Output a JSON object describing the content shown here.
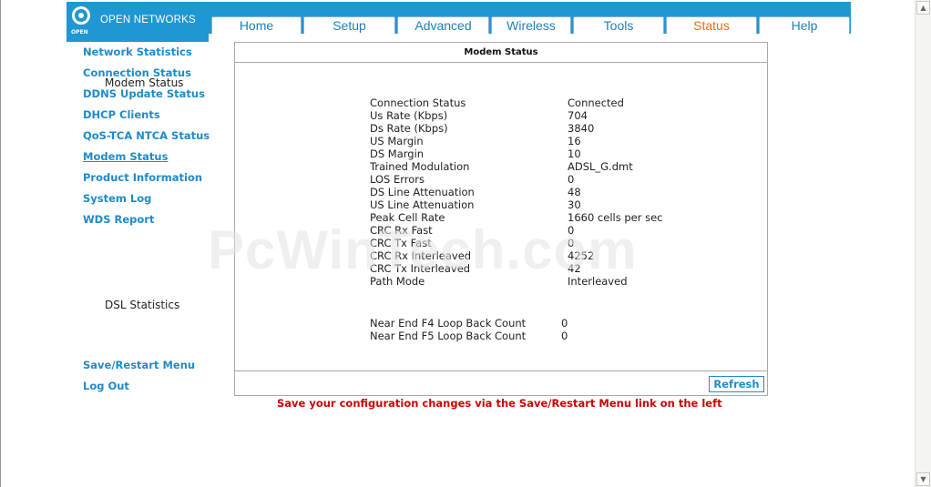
{
  "brand": {
    "logo_small": "OPEN",
    "name": "OPEN NETWORKS"
  },
  "tabs": [
    {
      "label": "Home"
    },
    {
      "label": "Setup"
    },
    {
      "label": "Advanced"
    },
    {
      "label": "Wireless"
    },
    {
      "label": "Tools"
    },
    {
      "label": "Status"
    },
    {
      "label": "Help"
    }
  ],
  "active_tab": "Status",
  "nav": {
    "items": [
      {
        "label": "Network Statistics"
      },
      {
        "label": "Connection Status"
      },
      {
        "label": "DDNS Update Status"
      },
      {
        "label": "DHCP Clients"
      },
      {
        "label": "QoS-TCA NTCA Status"
      },
      {
        "label": "Modem Status"
      },
      {
        "label": "Product Information"
      },
      {
        "label": "System Log"
      },
      {
        "label": "WDS Report"
      }
    ],
    "bottom": [
      {
        "label": "Save/Restart Menu"
      },
      {
        "label": "Log Out"
      }
    ]
  },
  "panel": {
    "title": "Modem Status",
    "section1": "Modem Status",
    "modem_rows": [
      {
        "label": "Connection Status",
        "value": "Connected"
      },
      {
        "label": "Us Rate (Kbps)",
        "value": "704"
      },
      {
        "label": "Ds Rate (Kbps)",
        "value": "3840"
      },
      {
        "label": "US Margin",
        "value": "16"
      },
      {
        "label": "DS Margin",
        "value": "10"
      },
      {
        "label": "Trained Modulation",
        "value": "ADSL_G.dmt"
      },
      {
        "label": "LOS Errors",
        "value": "0"
      },
      {
        "label": "DS Line Attenuation",
        "value": "48"
      },
      {
        "label": "US Line Attenuation",
        "value": "30"
      },
      {
        "label": "Peak Cell Rate",
        "value": "1660 cells per sec"
      },
      {
        "label": "CRC Rx Fast",
        "value": "0"
      },
      {
        "label": "CRC Tx Fast",
        "value": "0"
      },
      {
        "label": "CRC Rx Interleaved",
        "value": "4252"
      },
      {
        "label": "CRC Tx Interleaved",
        "value": "42"
      },
      {
        "label": "Path Mode",
        "value": "Interleaved"
      }
    ],
    "section2": "DSL Statistics",
    "dsl_rows": [
      {
        "label": "Near End F4 Loop Back Count",
        "value": "0"
      },
      {
        "label": "Near End F5 Loop Back Count",
        "value": "0"
      }
    ],
    "refresh_label": "Refresh"
  },
  "watermark": "PcWinTech.com",
  "notice": "Save your configuration changes via the Save/Restart Menu link on the left",
  "colors": {
    "brand_blue": "#1e97d3",
    "link_blue": "#1e8bc9",
    "active_tab": "#ee6b1a",
    "notice_red": "#d00000"
  }
}
